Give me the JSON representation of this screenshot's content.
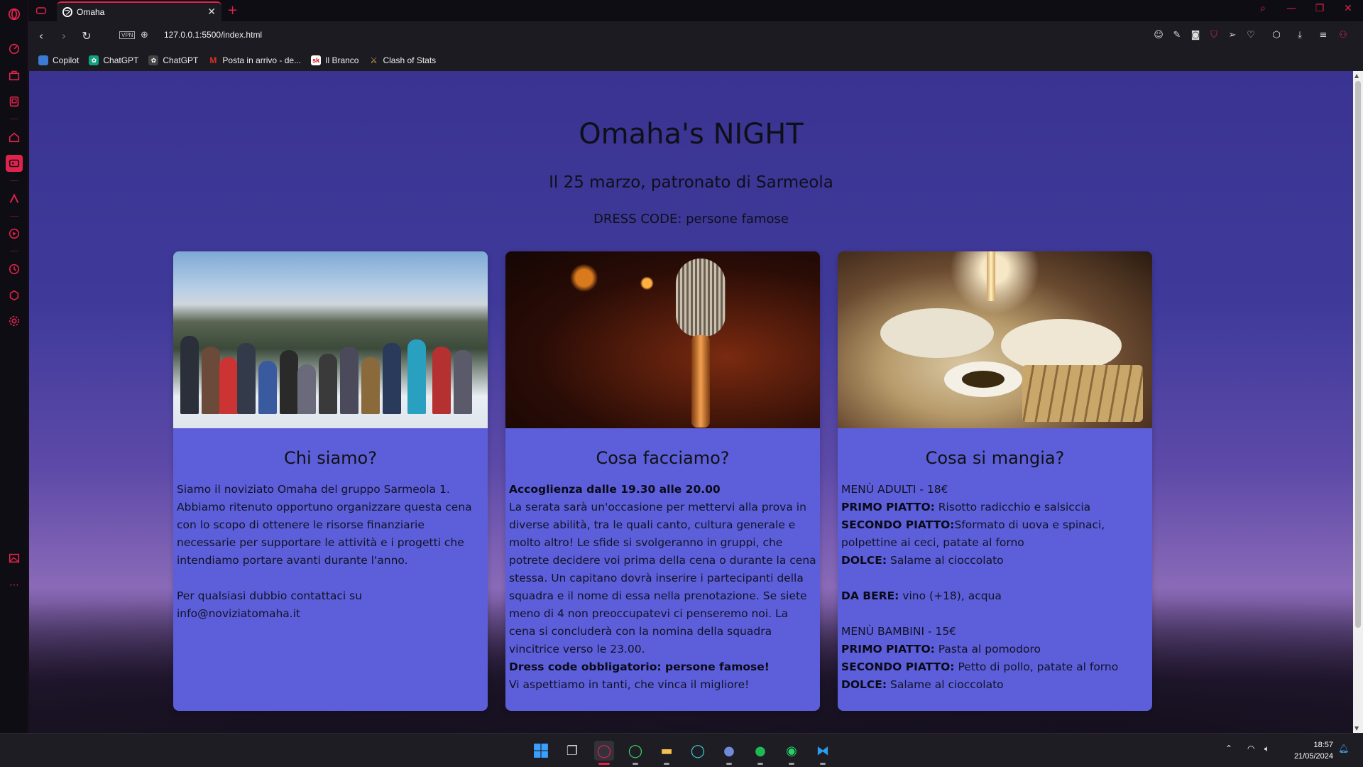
{
  "browser": {
    "tab_title": "Omaha",
    "url": "127.0.0.1:5500/index.html",
    "vpn_label": "VPN",
    "accent": "#e0234c"
  },
  "bookmarks": [
    {
      "label": "Copilot",
      "icon": "copilot-icon",
      "color": "#3b7bd4"
    },
    {
      "label": "ChatGPT",
      "icon": "chatgpt-icon",
      "color": "#10a37f"
    },
    {
      "label": "ChatGPT",
      "icon": "chatgpt-icon",
      "color": "#444444"
    },
    {
      "label": "Posta in arrivo - de...",
      "icon": "gmail-icon",
      "color": "#d93025"
    },
    {
      "label": "Il Branco",
      "icon": "sk-icon",
      "color": "#ffffff"
    },
    {
      "label": "Clash of Stats",
      "icon": "clash-icon",
      "color": "#d4a04a"
    }
  ],
  "page": {
    "title": "Omaha's NIGHT",
    "subtitle": "Il 25 marzo, patronato di Sarmeola",
    "dress_code": "DRESS CODE: persone famose"
  },
  "cards": [
    {
      "heading": "Chi siamo?",
      "image": "group-photo-mountains",
      "paragraphs": [
        "Siamo il noviziato Omaha del gruppo Sarmeola 1. Abbiamo ritenuto opportuno organizzare questa cena con lo scopo di ottenere le risorse finanziarie necessarie per supportare le attività e i progetti che intendiamo portare avanti durante l'anno.",
        "Per qualsiasi dubbio contattaci su info@noviziatomaha.it"
      ]
    },
    {
      "heading": "Cosa facciamo?",
      "image": "microphone-photo",
      "intro_bold": "Accoglienza dalle 19.30 alle 20.00",
      "text": "La serata sarà un'occasione per mettervi alla prova in diverse abilità, tra le quali canto, cultura generale e molto altro! Le sfide si svolgeranno in gruppi, che potrete decidere voi prima della cena o durante la cena stessa. Un capitano dovrà inserire i partecipanti della squadra e il nome di essa nella prenotazione. Se siete meno di 4 non preoccupatevi ci penseremo noi. La cena si concluderà con la nomina della squadra vincitrice verso le 23.00.",
      "outro_bold": "Dress code obbligatorio: persone famose!",
      "outro": "Vi aspettiamo in tanti, che vinca il migliore!"
    },
    {
      "heading": "Cosa si mangia?",
      "image": "food-table-photo",
      "adult_menu": "MENÙ ADULTI - 18€",
      "adult_items": [
        {
          "label": "PRIMO PIATTO:",
          "value": " Risotto radicchio e salsiccia"
        },
        {
          "label": "SECONDO PIATTO:",
          "value": "Sformato di uova e spinaci, polpettine ai ceci, patate al forno"
        },
        {
          "label": "DOLCE:",
          "value": " Salame al cioccolato"
        }
      ],
      "drinks": {
        "label": "DA BERE:",
        "value": " vino (+18), acqua"
      },
      "kids_menu": "MENÙ BAMBINI - 15€",
      "kids_items": [
        {
          "label": "PRIMO PIATTO:",
          "value": " Pasta al pomodoro"
        },
        {
          "label": "SECONDO PIATTO:",
          "value": " Petto di pollo, patate al forno"
        },
        {
          "label": "DOLCE:",
          "value": " Salame al cioccolato"
        }
      ]
    }
  ],
  "taskbar": {
    "time": "18:57",
    "date": "21/05/2024"
  }
}
